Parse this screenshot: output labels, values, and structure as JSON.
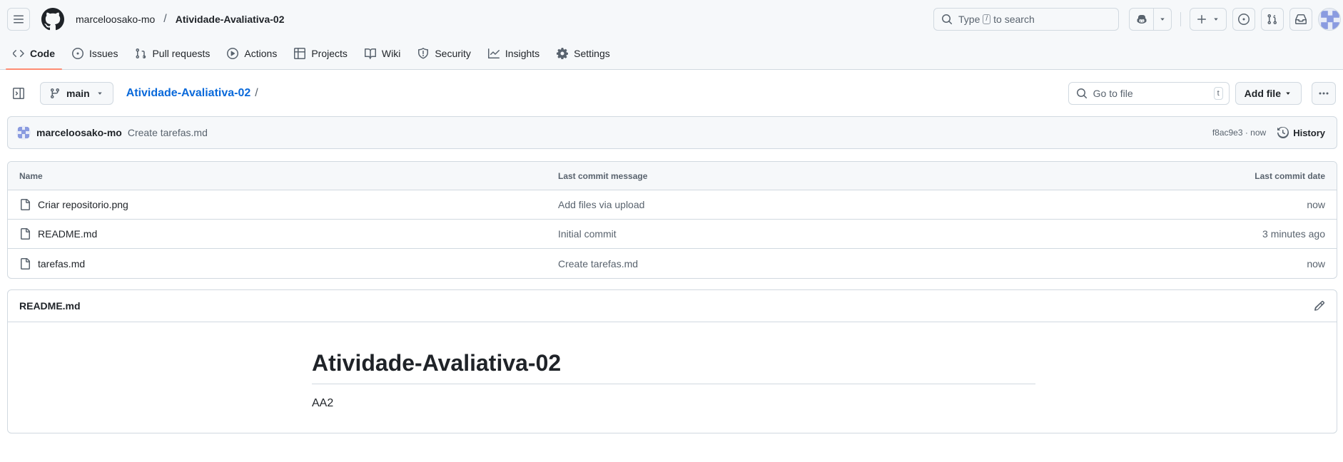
{
  "header": {
    "owner": "marceloosako-mo",
    "separator": "/",
    "repo": "Atividade-Avaliativa-02",
    "search_prefix": "Type",
    "search_key": "/",
    "search_suffix": "to search"
  },
  "nav": {
    "items": [
      {
        "label": "Code",
        "icon": "code-icon"
      },
      {
        "label": "Issues",
        "icon": "issue-icon"
      },
      {
        "label": "Pull requests",
        "icon": "pull-request-icon"
      },
      {
        "label": "Actions",
        "icon": "play-icon"
      },
      {
        "label": "Projects",
        "icon": "table-icon"
      },
      {
        "label": "Wiki",
        "icon": "book-icon"
      },
      {
        "label": "Security",
        "icon": "shield-icon"
      },
      {
        "label": "Insights",
        "icon": "graph-icon"
      },
      {
        "label": "Settings",
        "icon": "gear-icon"
      }
    ],
    "selected": "Code"
  },
  "repo_bar": {
    "branch": "main",
    "breadcrumb": "Atividade-Avaliativa-02",
    "breadcrumb_sep": "/",
    "goto_placeholder": "Go to file",
    "goto_key": "t",
    "add_file": "Add file"
  },
  "commit": {
    "author": "marceloosako-mo",
    "message": "Create tarefas.md",
    "sha_time": "f8ac9e3 · now",
    "history": "History"
  },
  "files": {
    "columns": [
      "Name",
      "Last commit message",
      "Last commit date"
    ],
    "rows": [
      {
        "name": "Criar repositorio.png",
        "message": "Add files via upload",
        "date": "now"
      },
      {
        "name": "README.md",
        "message": "Initial commit",
        "date": "3 minutes ago"
      },
      {
        "name": "tarefas.md",
        "message": "Create tarefas.md",
        "date": "now"
      }
    ]
  },
  "readme": {
    "filename": "README.md",
    "heading": "Atividade-Avaliativa-02",
    "body": "AA2"
  },
  "colors": {
    "link": "#0969da",
    "selected_underline": "#fd8c73",
    "border": "#d1d9e0",
    "muted_text": "#59636e"
  }
}
